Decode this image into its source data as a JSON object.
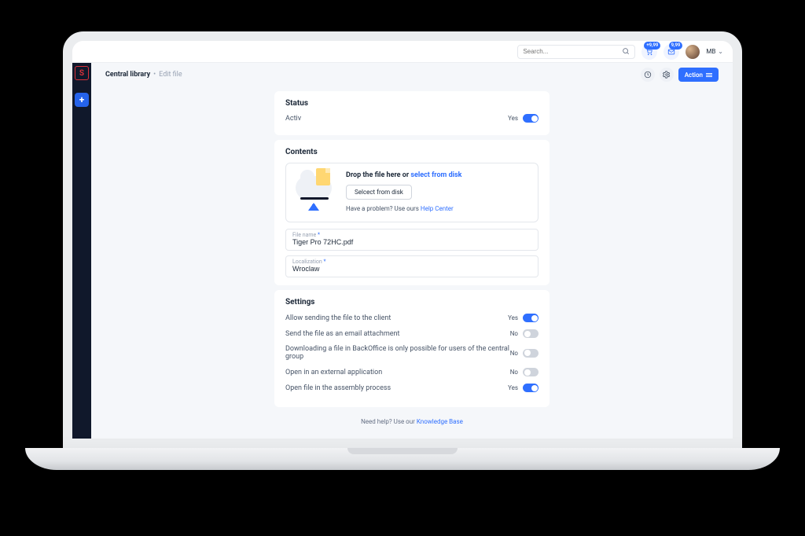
{
  "topbar": {
    "search_placeholder": "Search...",
    "notif1_count": "+9,99",
    "notif2_count": "9,99",
    "user_initials": "MB"
  },
  "breadcrumb": {
    "root": "Central library",
    "sep": "•",
    "leaf": "Edit file"
  },
  "header_action_label": "Action",
  "status_card": {
    "title": "Status",
    "label": "Activ",
    "value": "Yes"
  },
  "contents_card": {
    "title": "Contents",
    "drop_prefix": "Drop the file here or ",
    "drop_link": "select from disk",
    "select_button": "Selcect from disk",
    "help_prefix": "Have a problem? Use ours ",
    "help_link": "Help Center",
    "file_name_label": "File name",
    "file_name_value": "Tiger Pro 72HC.pdf",
    "localization_label": "Localization",
    "localization_value": "Wroclaw"
  },
  "settings_card": {
    "title": "Settings",
    "rows": [
      {
        "label": "Allow sending the file to the client",
        "value": "Yes",
        "on": true
      },
      {
        "label": "Send the file as an email attachment",
        "value": "No",
        "on": false
      },
      {
        "label": "Downloading a file in BackOffice is only possible for users of the central group",
        "value": "No",
        "on": false
      },
      {
        "label": "Open in an external application",
        "value": "No",
        "on": false
      },
      {
        "label": "Open file in the assembly process",
        "value": "Yes",
        "on": true
      }
    ]
  },
  "footer": {
    "prefix": "Need help? Use our ",
    "link": "Knowledge Base"
  },
  "required_mark": "*"
}
